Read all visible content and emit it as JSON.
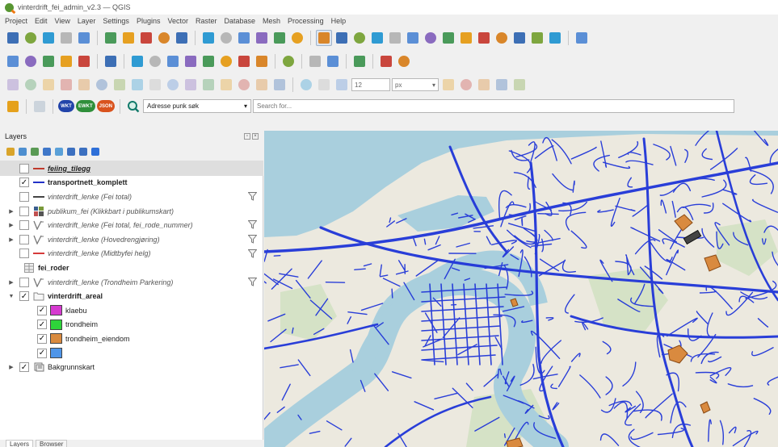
{
  "window": {
    "title": "vinterdrift_fei_admin_v2.3 — QGIS"
  },
  "menu": [
    "Project",
    "Edit",
    "View",
    "Layer",
    "Settings",
    "Plugins",
    "Vector",
    "Raster",
    "Database",
    "Mesh",
    "Processing",
    "Help"
  ],
  "toolbar": {
    "row1_icons": [
      "new-project-icon",
      "open-project-icon",
      "save-project-icon",
      "save-as-icon",
      "style-manager-icon",
      "sep",
      "digitize-icon",
      "pencil-icon",
      "save-edits-icon",
      "add-feature-icon",
      "vertex-tool-icon",
      "sep",
      "delete-icon",
      "cut-icon",
      "copy-icon",
      "paste-icon",
      "undo-icon",
      "redo-icon",
      "sep",
      "pan-icon",
      "pan-to-selection-icon",
      "zoom-in-icon",
      "zoom-out-icon",
      "zoom-full-icon",
      "zoom-selection-icon",
      "zoom-layer-icon",
      "zoom-native-icon",
      "zoom-last-icon",
      "zoom-next-icon",
      "new-bookmark-icon",
      "show-bookmarks-icon",
      "temporal-controller-icon",
      "refresh-icon",
      "sep",
      "identify-icon"
    ],
    "row2_icons": [
      "add-vector-layer-icon",
      "add-raster-layer-icon",
      "add-delimited-icon",
      "add-spatialite-icon",
      "add-wms-icon",
      "sep",
      "new-memory-layer-icon",
      "sep",
      "label-icon",
      "label-style-icon",
      "pin-labels-icon",
      "highlight-labels-icon",
      "show-hide-labels-icon",
      "move-label-icon",
      "rotate-label-icon",
      "change-label-icon",
      "sep",
      "database-icon",
      "sep",
      "python-console-icon",
      "wkt-tool-icon",
      "sep",
      "help-icon",
      "sep",
      "plugin-a-icon",
      "plugin-b-icon"
    ],
    "row3_icons": [
      "digitize-shape-icon",
      "vertex-editor-icon",
      "split-icon",
      "merge-icon",
      "reshape-icon",
      "offset-icon",
      "rotate-icon",
      "simplify-icon",
      "add-ring-icon",
      "add-part-icon",
      "fill-ring-icon",
      "delete-ring-icon",
      "delete-part-icon",
      "split-parts-icon",
      "reverse-line-icon",
      "trim-extend-icon",
      "sep",
      "snapping-icon",
      "snapping-options-icon",
      "tracing-icon"
    ],
    "snap_tolerance": "12",
    "snap_unit": "px",
    "row3_tail_icons": [
      "curve-icon",
      "select-vertex-icon",
      "close-x-icon",
      "disabled-x-icon",
      "node-icon"
    ]
  },
  "locator": {
    "buttons": [
      "WKT",
      "EWKT",
      "JSON"
    ],
    "button_colors": [
      "#2244aa",
      "#2f8f3a",
      "#d9531e"
    ],
    "select_value": "Adresse punk søk",
    "search_placeholder": "Search for..."
  },
  "layers_panel": {
    "title": "Layers",
    "tool_icons": [
      "open-styling-icon",
      "add-group-icon",
      "manage-themes-icon",
      "filter-legend-icon",
      "filter-expression-icon",
      "expand-all-icon",
      "collapse-all-icon",
      "remove-layer-icon"
    ],
    "layers": [
      {
        "name": "feiing_tilegg",
        "style": "italic-underline",
        "checked": false,
        "expand": "",
        "symbol": "line",
        "color": "#c0392b",
        "filter": false,
        "selected": true
      },
      {
        "name": "transportnett_komplett",
        "style": "bold",
        "checked": true,
        "expand": "",
        "symbol": "line",
        "color": "#2332c8",
        "filter": false,
        "selected": false
      },
      {
        "name": "vinterdrift_lenke (Fei total)",
        "style": "italic",
        "checked": false,
        "expand": "",
        "symbol": "line",
        "color": "#444444",
        "filter": true,
        "selected": false
      },
      {
        "name": "publikum_fei (Klikkbart i publikumskart)",
        "style": "italic",
        "checked": false,
        "expand": "▶",
        "symbol": "multi",
        "color": "#3a5f8f",
        "filter": false,
        "selected": false
      },
      {
        "name": "vinterdrift_lenke (Fei total, fei_rode_nummer)",
        "style": "italic",
        "checked": false,
        "expand": "▶",
        "symbol": "vline",
        "color": "#777777",
        "filter": true,
        "selected": false
      },
      {
        "name": "vinterdrift_lenke (Hovedrengjøring)",
        "style": "italic",
        "checked": false,
        "expand": "▶",
        "symbol": "vline",
        "color": "#777777",
        "filter": true,
        "selected": false
      },
      {
        "name": "vinterdrift_lenke (Midtbyfei helg)",
        "style": "italic",
        "checked": false,
        "expand": "",
        "symbol": "line",
        "color": "#d63a3a",
        "filter": true,
        "selected": false
      },
      {
        "name": "fei_roder",
        "style": "bold",
        "checked": null,
        "expand": "",
        "symbol": "table",
        "color": "#999999",
        "filter": false,
        "selected": false
      },
      {
        "name": "vinterdrift_lenke (Trondheim Parkering)",
        "style": "italic",
        "checked": false,
        "expand": "▶",
        "symbol": "vline",
        "color": "#777777",
        "filter": true,
        "selected": false
      },
      {
        "name": "vinterdrift_areal",
        "style": "bold",
        "checked": true,
        "expand": "▼",
        "symbol": "group",
        "color": "#888888",
        "filter": false,
        "selected": false
      },
      {
        "name": "klaebu",
        "style": "normal",
        "checked": true,
        "expand": "",
        "symbol": "swatch",
        "color": "#d63ad0",
        "filter": false,
        "selected": false,
        "indent": true
      },
      {
        "name": "trondheim",
        "style": "normal",
        "checked": true,
        "expand": "",
        "symbol": "swatch",
        "color": "#2ed43a",
        "filter": false,
        "selected": false,
        "indent": true
      },
      {
        "name": "trondheim_eiendom",
        "style": "normal",
        "checked": true,
        "expand": "",
        "symbol": "swatch",
        "color": "#d98a3f",
        "filter": false,
        "selected": false,
        "indent": true
      },
      {
        "name": "",
        "style": "normal",
        "checked": true,
        "expand": "",
        "symbol": "swatch",
        "color": "#4f95e8",
        "filter": false,
        "selected": false,
        "indent": true
      },
      {
        "name": "Bakgrunnskart",
        "style": "normal",
        "checked": true,
        "expand": "▶",
        "symbol": "group-map",
        "color": "#888888",
        "filter": false,
        "selected": false
      }
    ],
    "tabs": [
      "Layers",
      "Browser"
    ]
  },
  "map": {
    "road_color": "#1f35d8",
    "water_color": "#a9cfdd",
    "land_color": "#ece9df",
    "park_color": "#cfe0bf"
  }
}
